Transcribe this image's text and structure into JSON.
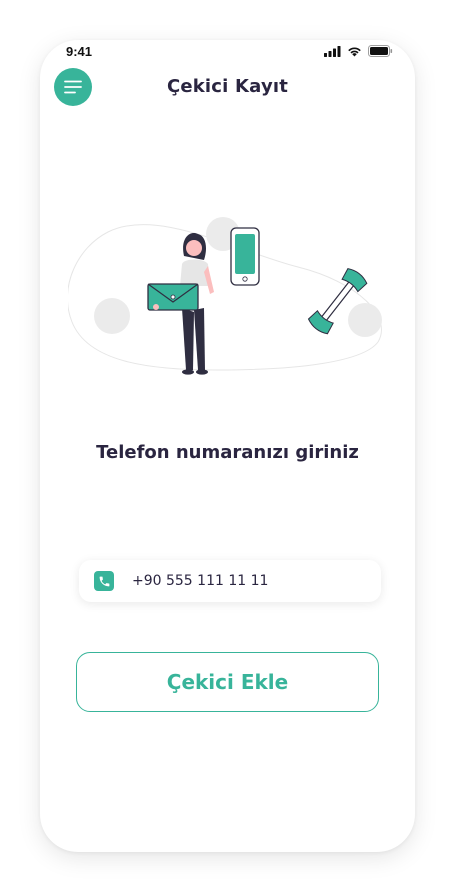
{
  "status_bar": {
    "time": "9:41",
    "icons": [
      "signal-icon",
      "wifi-icon",
      "battery-icon"
    ]
  },
  "header": {
    "title": "Çekici Kayıt",
    "menu_icon": "menu-icon"
  },
  "main": {
    "prompt": "Telefon numaranızı giriniz",
    "phone_field": {
      "icon": "phone-icon",
      "value": "+90 555 111 11 11"
    },
    "submit_label": "Çekici Ekle"
  },
  "colors": {
    "accent": "#38b49a",
    "title_text": "#2a2540",
    "background": "#ffffff"
  }
}
